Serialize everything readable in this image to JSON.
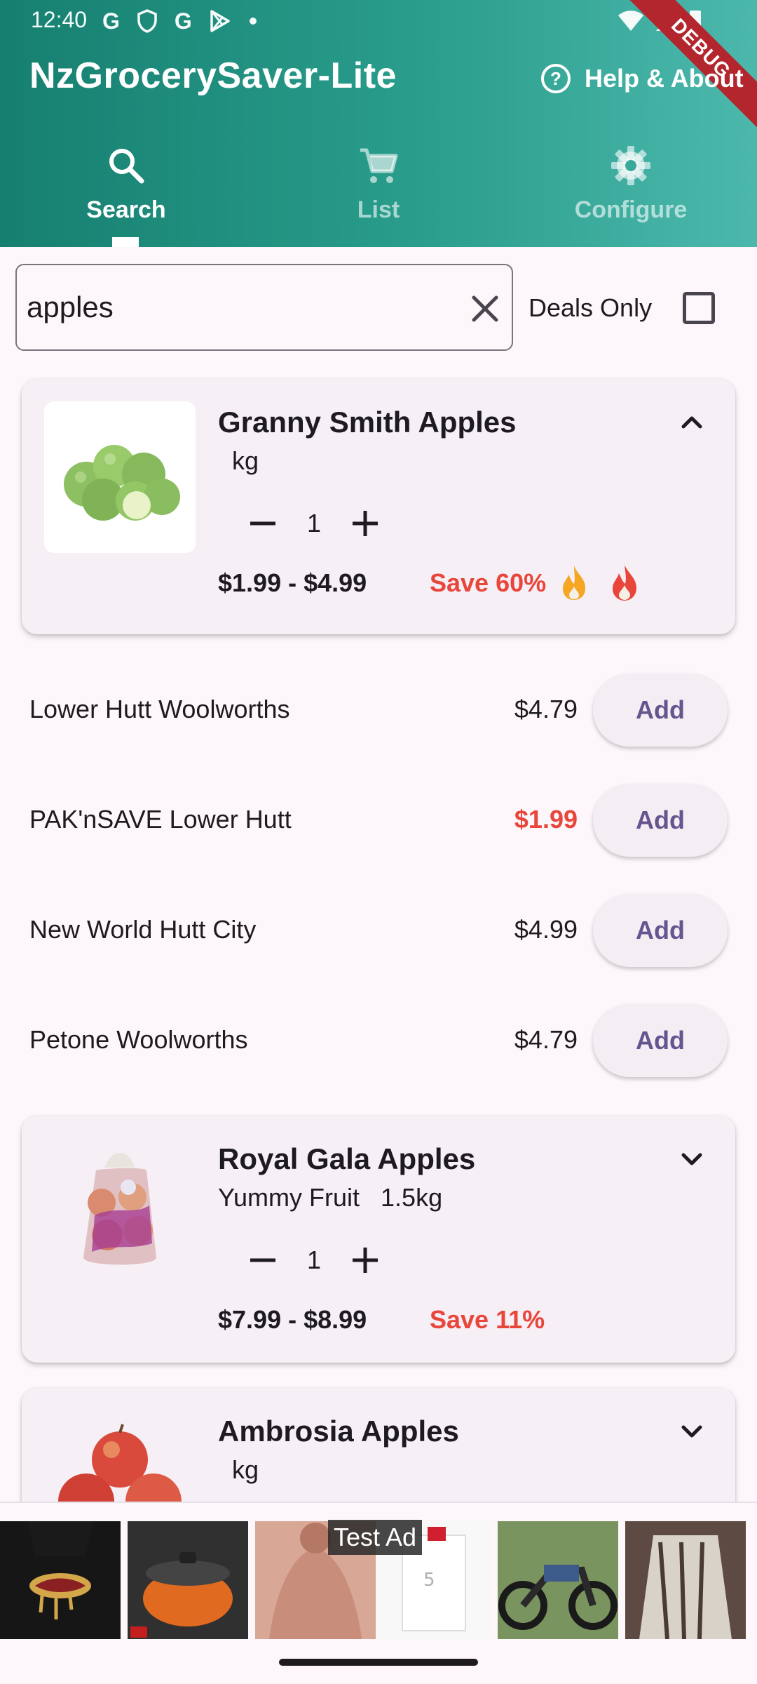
{
  "status_bar": {
    "time": "12:40"
  },
  "header": {
    "title": "NzGrocerySaver-Lite",
    "help_label": "Help & About",
    "debug_label": "DEBUG",
    "accent_color": "#2a9d8c"
  },
  "tabs": [
    {
      "label": "Search",
      "icon": "search-icon",
      "active": true
    },
    {
      "label": "List",
      "icon": "cart-icon",
      "active": false
    },
    {
      "label": "Configure",
      "icon": "gear-icon",
      "active": false
    }
  ],
  "search": {
    "value": "apples",
    "deals_only_label": "Deals Only",
    "deals_only_checked": false
  },
  "products": [
    {
      "name": "Granny Smith Apples",
      "subtitle": "  kg",
      "quantity": "1",
      "price_range": "$1.99 - $4.99",
      "save": "Save 60%",
      "expanded": true,
      "stores": [
        {
          "name": "Lower Hutt Woolworths",
          "price": "$4.79",
          "deal": false,
          "add_label": "Add"
        },
        {
          "name": "PAK'nSAVE Lower Hutt",
          "price": "$1.99",
          "deal": true,
          "add_label": "Add"
        },
        {
          "name": "New World Hutt City",
          "price": "$4.99",
          "deal": false,
          "add_label": "Add"
        },
        {
          "name": "Petone Woolworths",
          "price": "$4.79",
          "deal": false,
          "add_label": "Add"
        }
      ]
    },
    {
      "name": "Royal Gala Apples",
      "subtitle": "Yummy Fruit   1.5kg",
      "quantity": "1",
      "price_range": "$7.99 - $8.99",
      "save": "Save 11%",
      "expanded": false
    },
    {
      "name": "Ambrosia Apples",
      "subtitle": "  kg",
      "expanded": false
    }
  ],
  "ad": {
    "label": "Test Ad"
  },
  "colors": {
    "deal_red": "#e8463a",
    "add_text": "#65558f"
  }
}
